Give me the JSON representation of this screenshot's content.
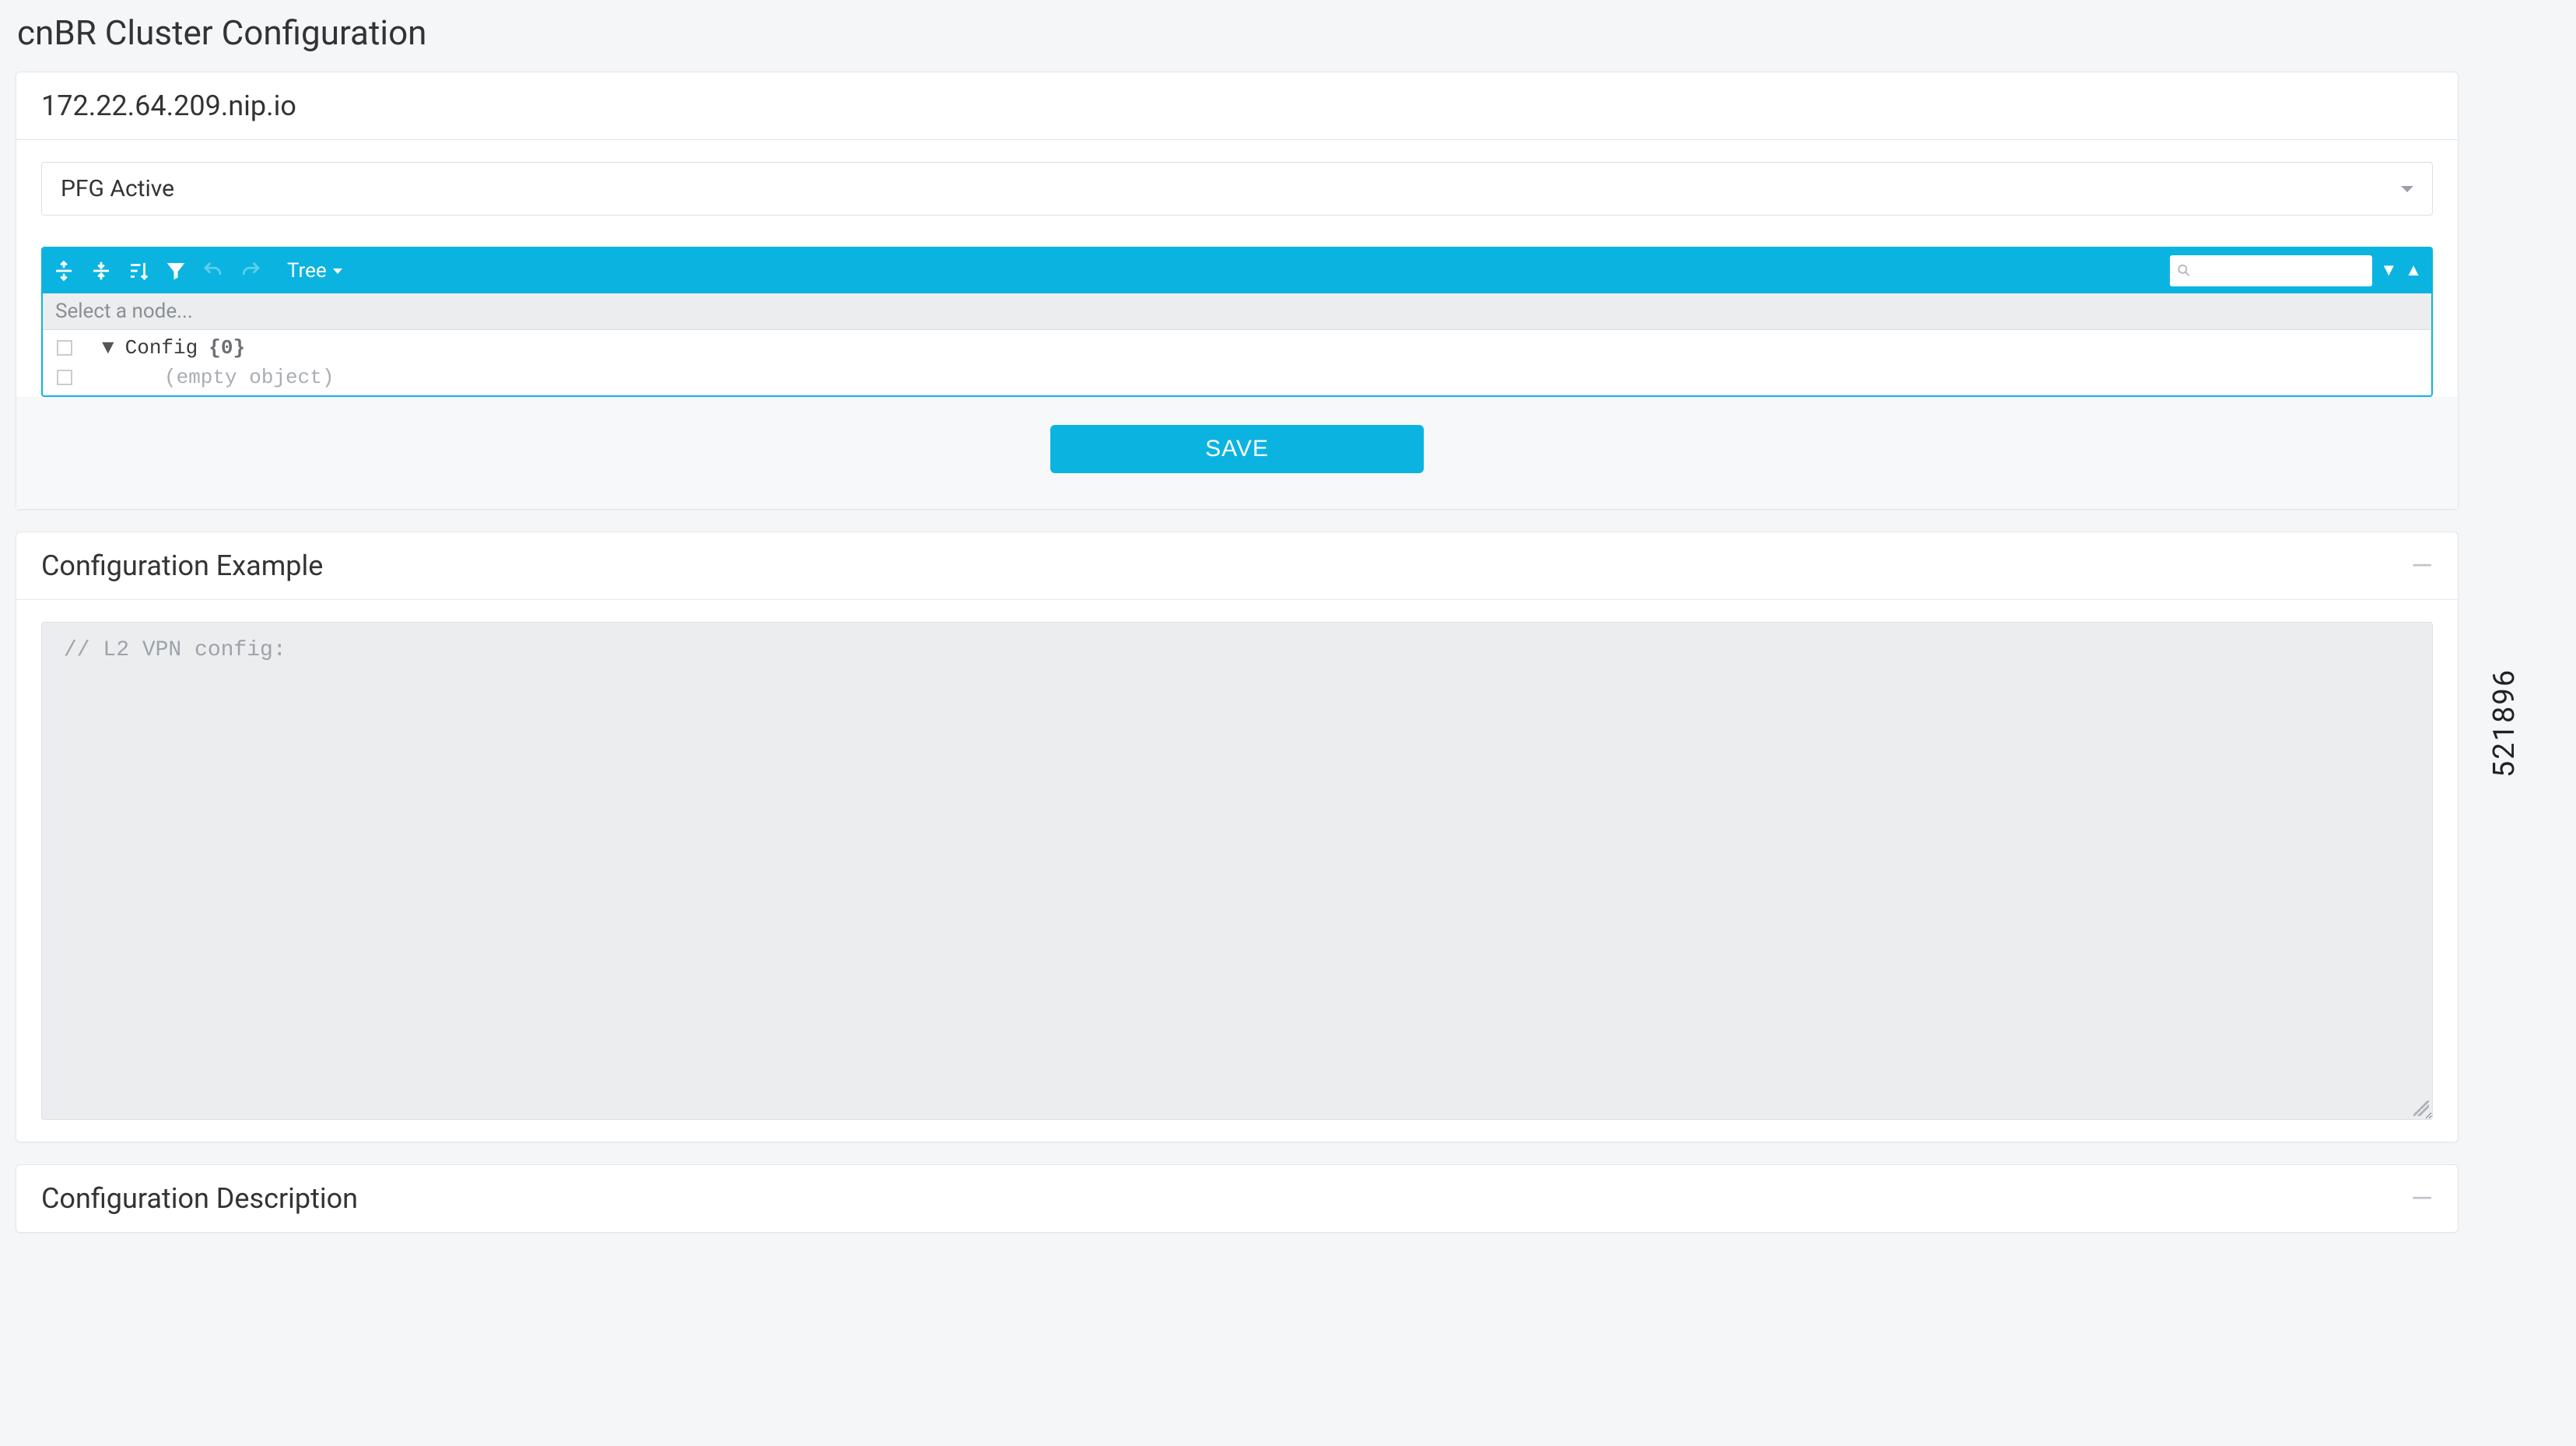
{
  "page_title": "cnBR Cluster Configuration",
  "cluster_host": "172.22.64.209.nip.io",
  "select": {
    "value": "PFG Active"
  },
  "editor_toolbar": {
    "view_label": "Tree",
    "search_placeholder": ""
  },
  "editor_breadcrumb": "Select a node...",
  "tree": {
    "root_key": "Config",
    "root_count": "{0}",
    "empty_label": "(empty object)"
  },
  "save_label": "SAVE",
  "example_panel": {
    "title": "Configuration Example",
    "content": "// L2 VPN config:"
  },
  "description_panel": {
    "title": "Configuration Description"
  },
  "side_number": "521896"
}
